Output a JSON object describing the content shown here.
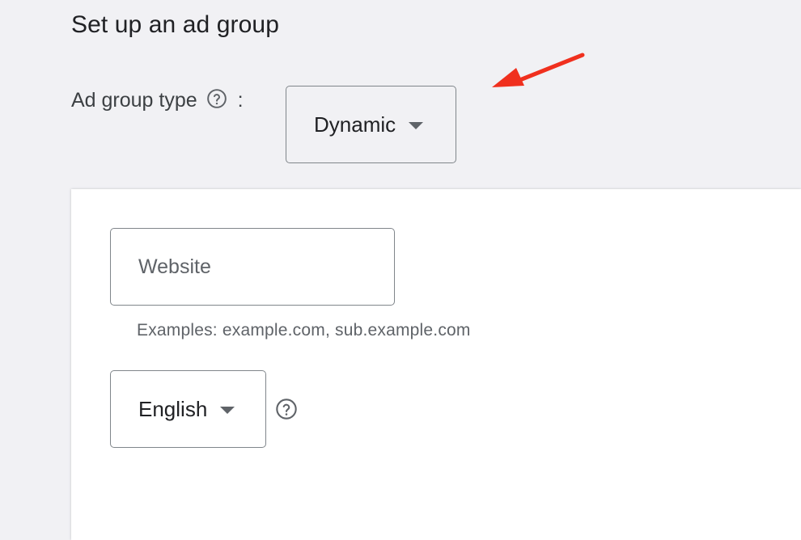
{
  "page": {
    "title": "Set up an ad group"
  },
  "ad_group_type": {
    "label": "Ad group type",
    "separator": ":",
    "selected": "Dynamic",
    "help_icon": "help-circle-icon"
  },
  "annotation": {
    "icon": "red-arrow-icon",
    "color": "#f0301e"
  },
  "website": {
    "placeholder": "Website",
    "value": "",
    "hint": "Examples: example.com, sub.example.com"
  },
  "language": {
    "selected": "English",
    "help_icon": "help-circle-icon"
  },
  "colors": {
    "background": "#f1f1f4",
    "card": "#ffffff",
    "border": "#80868b",
    "text": "#202124",
    "secondary_text": "#5f6368"
  }
}
